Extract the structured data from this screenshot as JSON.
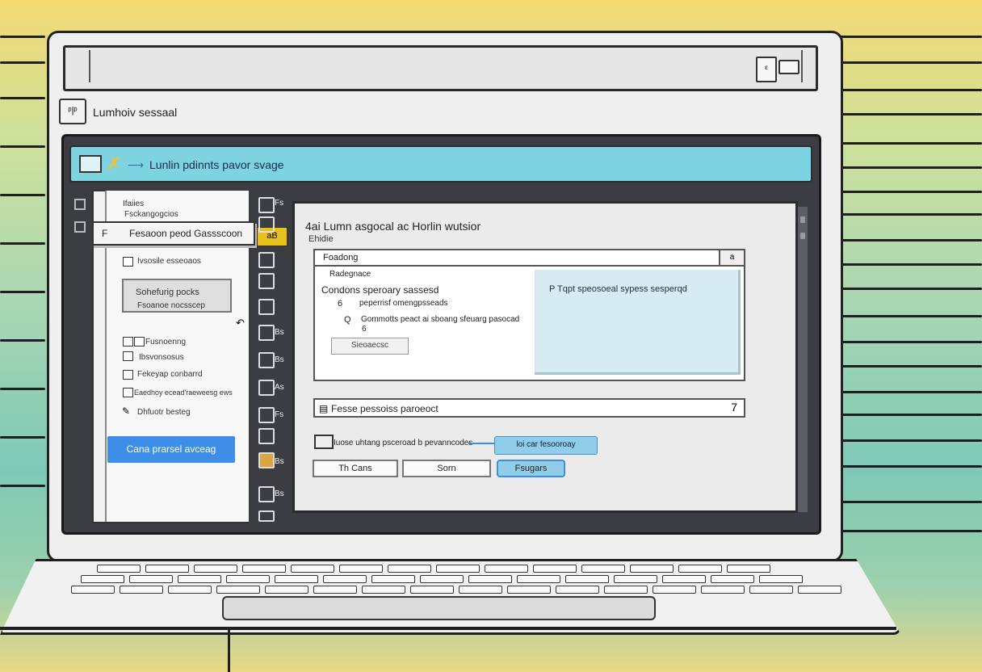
{
  "app": {
    "title": "Lumhoiv sessaal",
    "top_icon_glyph": "ᵋ",
    "app_icon_glyph": "ᵖ|ᵖ"
  },
  "toolbar": {
    "title": "Lunlin pdinnts pavor svage",
    "check_icon": "check-icon"
  },
  "sidebar": {
    "header_line1": "Ifaiies",
    "header_line2": "Fsckangogcios",
    "selected_prefix": "F",
    "selected_label": "Fesaoon peod  Gassscoon",
    "selected_suffix": "aB",
    "items": [
      {
        "label": "Ivsosile esseoaos"
      },
      {
        "label": "Sohefurig pocks",
        "sub": "Fsoanoe nocsscep"
      },
      {
        "label": "Fusnoenng"
      },
      {
        "label": "Ibsvonsosus"
      },
      {
        "label": "Fekeyap conbarrd"
      },
      {
        "label": "Eaedhoy ecead'raeweesg ews"
      },
      {
        "label": "Dhfuotr besteg"
      }
    ],
    "primary_button": "Cana prarsel avceag"
  },
  "toolstrip": {
    "items": [
      "Fs",
      "",
      "bB",
      "",
      "Es",
      "",
      "Bs",
      "Bs",
      "As",
      "Fs",
      "Bs",
      "Bs"
    ]
  },
  "main": {
    "title": "4ai Lumn asgocal ac Horlin wutsior",
    "subtitle": "Ehidie",
    "search_value": "Foadong",
    "search_button": "a",
    "list": [
      "Radegnace",
      "Condons speroary sassesd",
      "peperrisf omengpsseads",
      "Gommotts peact ai sboang sfeuarg pasocad",
      "6"
    ],
    "list_markers": [
      "6",
      "Q"
    ],
    "list_button": "Sieoaecsc",
    "highlight_text": "P Tqpt speosoeal sypess sesperqd",
    "input_value": "Fesse pessoiss paroeoct",
    "input_arrow": "7",
    "option_text": "Iuose uhtang psceroad b pevanncodes",
    "option_pill": "loi car fesooroay",
    "buttons": {
      "cancel": "Th Cans",
      "save": "Sorn",
      "primary": "Fsugars"
    }
  },
  "colors": {
    "toolbar": "#7ed3e1",
    "primary": "#3d8ee6",
    "highlight": "#d7ebf3",
    "pill": "#8fcde8"
  }
}
